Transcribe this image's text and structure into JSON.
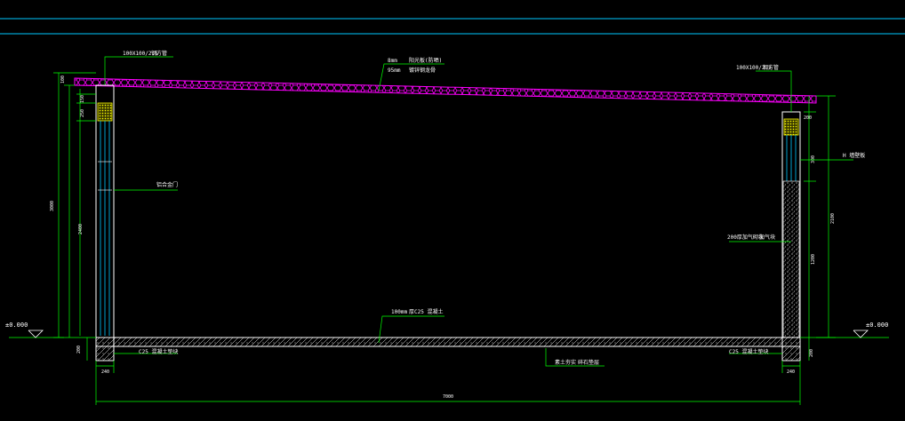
{
  "colors": {
    "background": "#000000",
    "frame": "#00c8ff",
    "dimension": "#00ff00",
    "roof": "#ff00ff",
    "column": "#ffffff",
    "text": "#ffffff",
    "cap": "#ffff00"
  },
  "labels": {
    "left_top_spec": "100X100/2.5",
    "left_top_material": "钢方管",
    "roof_spec_1": "8mm",
    "roof_material_1": "阳光板(防晒)",
    "roof_spec_2": "95mm",
    "roof_material_2": "镀锌钢龙骨",
    "right_top_spec": "100X100/2.5",
    "right_top_material": "钢方管",
    "right_side": "H 墙壁板",
    "left_door": "铝合金门",
    "right_wall_spec": "200厚加气砌块",
    "right_wall_material": "加气块",
    "floor_spec": "100mm",
    "floor_material": "厚C25 混凝土",
    "left_base": "C25 混凝土垫块",
    "right_base": "C25 混凝土垫块",
    "subgrade_spec": "素土夯实",
    "subgrade_material": "碎石垫层",
    "elev_left": "±0.000",
    "elev_right": "±0.000"
  },
  "dimensions": {
    "total_height": "3000",
    "left_mid": "2400",
    "left_small_1": "150",
    "left_small_2": "250",
    "left_top": "100",
    "base_left": "200",
    "base_width_left": "240",
    "base_width_right": "240",
    "total_width": "7000",
    "right_top": "200",
    "right_mid": "2100",
    "right_h1": "300",
    "right_h2": "1200",
    "right_base": "200"
  }
}
